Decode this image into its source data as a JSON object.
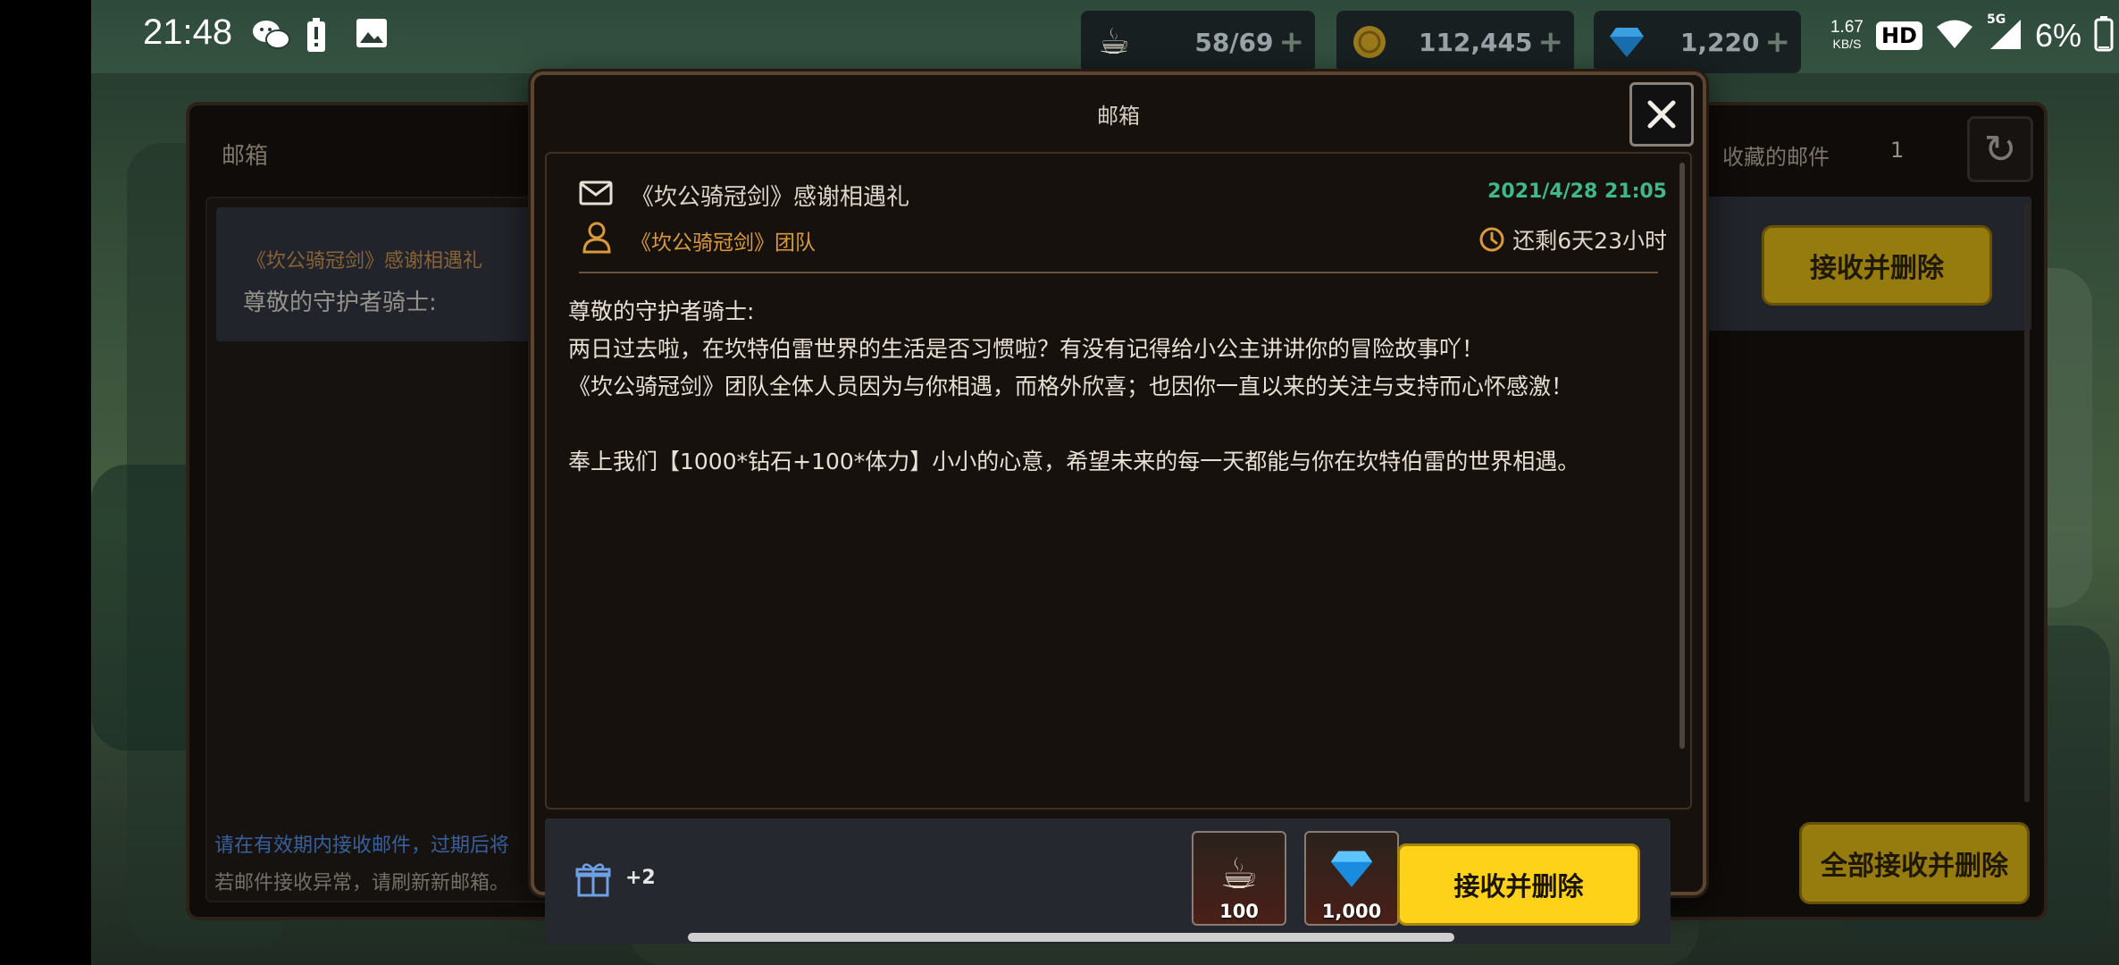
{
  "status_bar": {
    "time": "21:48",
    "speed_value": "1.67",
    "speed_unit": "KB/S",
    "hd": "HD",
    "network": "5G",
    "battery": "6%"
  },
  "currency": {
    "stamina": "58/69",
    "gold": "112,445",
    "gems": "1,220",
    "plus": "+"
  },
  "background_panel": {
    "title": "邮箱",
    "mail_subject": "《坎公骑冠剑》感谢相遇礼",
    "mail_preview": "尊敬的守护者骑士:",
    "note1": "请在有效期内接收邮件，过期后将",
    "note2": "若邮件接收异常，请刷新新邮箱。",
    "favorites_label": "收藏的邮件",
    "favorites_count": "1",
    "receive_delete": "接收并删除",
    "receive_all": "全部接收并删除"
  },
  "modal": {
    "title": "邮箱",
    "subject": "《坎公骑冠剑》感谢相遇礼",
    "date": "2021/4/28 21:05",
    "sender": "《坎公骑冠剑》团队",
    "remaining": "还剩6天23小时",
    "body": [
      "尊敬的守护者骑士:",
      "两日过去啦，在坎特伯雷世界的生活是否习惯啦？有没有记得给小公主讲讲你的冒险故事吖！",
      "《坎公骑冠剑》团队全体人员因为与你相遇，而格外欣喜；也因你一直以来的关注与支持而心怀感激！",
      "",
      "奉上我们【1000*钻石+100*体力】小小的心意，希望未来的每一天都能与你在坎特伯雷的世界相遇。"
    ],
    "gift_count": "+2",
    "items": [
      {
        "icon": "coffee-cup-icon",
        "qty": "100"
      },
      {
        "icon": "diamond-icon",
        "qty": "1,000"
      }
    ],
    "receive_button": "接收并删除"
  },
  "colors": {
    "accent_yellow": "#ffd21a",
    "date_green": "#3fb88a",
    "sender_orange": "#d89a3c"
  }
}
